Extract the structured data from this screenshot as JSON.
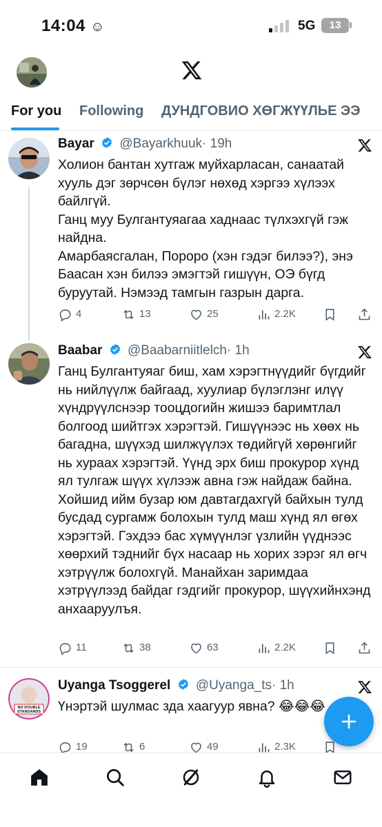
{
  "status_bar": {
    "time": "14:04",
    "network": "5G",
    "battery": "13"
  },
  "tabs": [
    {
      "label": "For you",
      "active": true
    },
    {
      "label": "Following",
      "active": false
    },
    {
      "label": "ДУНДГОВИО ХӨГЖҮҮЛЬЕ ЭЭ",
      "active": false
    }
  ],
  "posts": [
    {
      "name": "Bayar",
      "handle": "@Bayarkhuuk",
      "time": "· 19h",
      "lines": [
        "Холион бантан хутгаж муйхарласан, санаатай хууль дэг зөрчсөн бүлэг нөхөд хэргээ хүлээх байлгүй.",
        "Ганц муу Булгантуяагаа хаднаас түлхэхгүй гэж найдна.",
        "Амарбаясгалан, Пороро (хэн гэдэг билээ?), энэ Баасан хэн билээ эмэгтэй гишүүн, ОЭ бүгд буруутай. Нэмээд тамгын газрын дарга."
      ],
      "replies": "4",
      "reposts": "13",
      "likes": "25",
      "views": "2.2K"
    },
    {
      "name": "Baabar",
      "handle": "@Baabarniitlelch",
      "time": "· 1h",
      "lines": [
        "Ганц Булгантуяаг биш, хам хэрэгтнүүдийг бүгдийг нь нийлүүлж байгаад, хуулиар бүлэглэнг илүү хүндрүүлснээр тооцдогийн жишээ баримтлал болгоод шийтгэх хэрэгтэй. Гишүүнээс нь хөөх  нь багадна, шүүхэд шилжүүлэх төдийгүй хөрөнгийг нь хураах хэрэгтэй. Үүнд эрх биш прокурор хүнд ял тулгаж шүүх хүлээж авна гэж найдаж байна. Хойшид ийм бузар юм давтагдахгүй байхын тулд бусдад сургамж болохын тулд маш хүнд ял өгөх хэрэгтэй. Гэхдээ бас хүмүүнлэг үзлийн үүднээс хөөрхий тэднийг бүх насаар нь хорих зэрэг ял өгч хэтрүүлж болохгүй. Манайхан заримдаа хэтрүүлээд байдаг гэдгийг прокурор, шүүхийнхэнд анхааруулъя."
      ],
      "replies": "11",
      "reposts": "38",
      "likes": "63",
      "views": "2.2K"
    },
    {
      "name": "Uyanga Tsoggerel",
      "handle": "@Uyanga_ts",
      "time": "· 1h",
      "lines": [
        "Үнэртэй шулмас зда хаагуур явна? 😂😂😂"
      ],
      "replies": "19",
      "reposts": "6",
      "likes": "49",
      "views": "2.3K",
      "avatar_caption": "NO DOUBLE STANDARDS"
    }
  ],
  "colors": {
    "accent": "#1d9bf0",
    "verified": "#1d9bf0",
    "muted": "#536471"
  },
  "icons": {
    "header": [
      "x-logo-icon"
    ],
    "actions": [
      "reply-icon",
      "repost-icon",
      "like-icon",
      "views-icon",
      "bookmark-icon",
      "share-icon"
    ],
    "nav": [
      "home-icon",
      "search-icon",
      "grok-icon",
      "notifications-icon",
      "messages-icon"
    ],
    "fab": "plus-icon"
  }
}
